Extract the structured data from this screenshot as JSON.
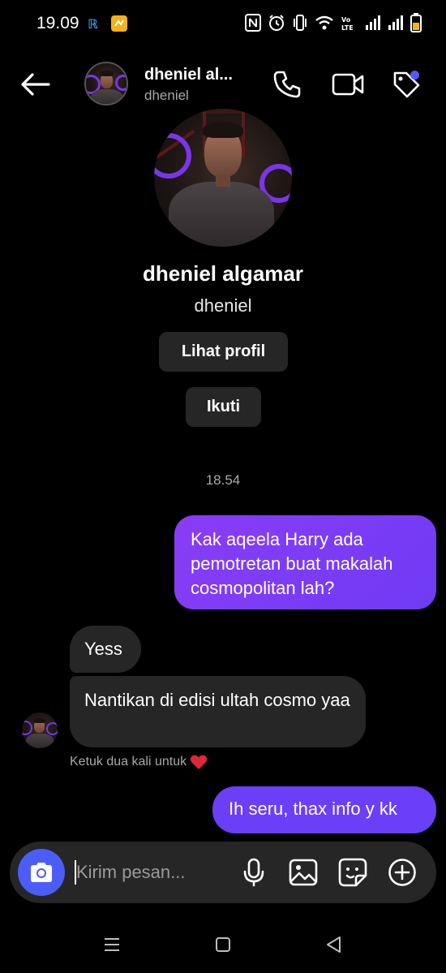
{
  "status_bar": {
    "time": "19.09",
    "volte_label": "Vo LTE"
  },
  "header": {
    "display_name": "dheniel al...",
    "username": "dheniel"
  },
  "profile": {
    "full_name": "dheniel algamar",
    "username": "dheniel",
    "view_profile_label": "Lihat profil",
    "follow_label": "Ikuti"
  },
  "conversation": {
    "timestamp": "18.54",
    "messages": [
      {
        "direction": "outgoing",
        "text": "Kak aqeela Harry ada pemotretan buat makalah cosmopolitan lah?"
      },
      {
        "direction": "incoming",
        "text": "Yess"
      },
      {
        "direction": "incoming",
        "text": "Nantikan di edisi ultah cosmo yaa"
      },
      {
        "direction": "outgoing",
        "text": "Ih seru, thax info y kk"
      }
    ],
    "react_hint": "Ketuk dua kali untuk",
    "react_emoji": "heart-emoji"
  },
  "composer": {
    "placeholder": "Kirim pesan...",
    "value": ""
  },
  "colors": {
    "background": "#000000",
    "outgoing_bubble": "#7b3cf6",
    "incoming_bubble": "#262626",
    "camera_button": "#4c5df7",
    "notification_dot": "#4f5bff"
  }
}
